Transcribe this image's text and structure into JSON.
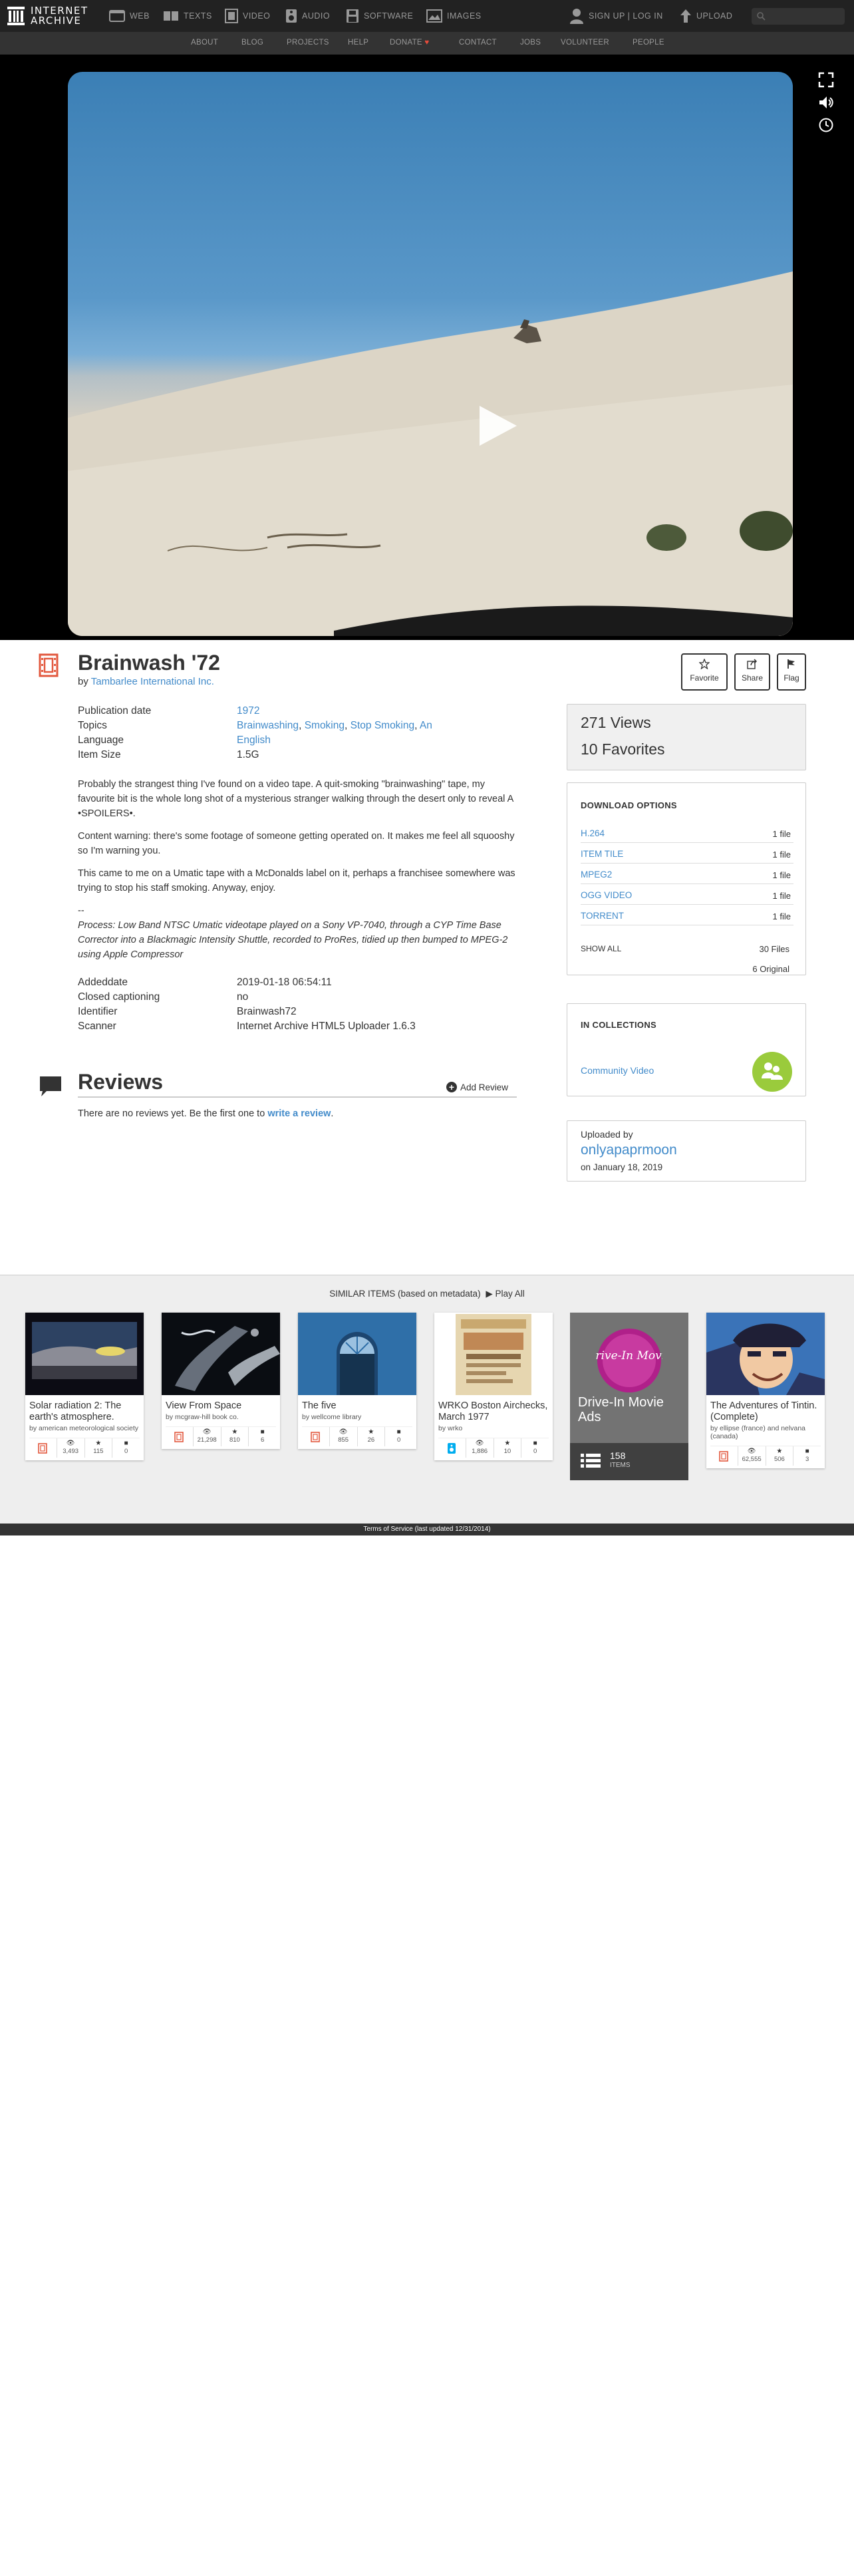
{
  "topnav": {
    "logo_line1": "INTERNET",
    "logo_line2": "ARCHIVE",
    "items": [
      {
        "label": "WEB",
        "icon": "web-icon"
      },
      {
        "label": "TEXTS",
        "icon": "book-icon"
      },
      {
        "label": "VIDEO",
        "icon": "film-icon"
      },
      {
        "label": "AUDIO",
        "icon": "speaker-icon"
      },
      {
        "label": "SOFTWARE",
        "icon": "floppy-icon"
      },
      {
        "label": "IMAGES",
        "icon": "image-icon"
      }
    ],
    "account": "SIGN UP | LOG IN",
    "upload": "UPLOAD"
  },
  "subnav": {
    "items": [
      "ABOUT",
      "BLOG",
      "PROJECTS",
      "HELP",
      "DONATE",
      "CONTACT",
      "JOBS",
      "VOLUNTEER",
      "PEOPLE"
    ],
    "donate_heart": "♥"
  },
  "item": {
    "title": "Brainwash '72",
    "by_prefix": "by",
    "creator": "Tambarlee International Inc.",
    "actions": {
      "favorite": "Favorite",
      "share": "Share",
      "flag": "Flag"
    }
  },
  "metadata": {
    "publication_date_label": "Publication date",
    "publication_date": "1972",
    "topics_label": "Topics",
    "topics": [
      "Brainwashing",
      "Smoking",
      "Stop Smoking",
      "An"
    ],
    "language_label": "Language",
    "language": "English",
    "item_size_label": "Item Size",
    "item_size": "1.5G",
    "addeddate_label": "Addeddate",
    "addeddate": "2019-01-18 06:54:11",
    "captioning_label": "Closed captioning",
    "captioning": "no",
    "identifier_label": "Identifier",
    "identifier": "Brainwash72",
    "scanner_label": "Scanner",
    "scanner": "Internet Archive HTML5 Uploader 1.6.3"
  },
  "description": {
    "p1": "Probably the strangest thing I've found on a video tape.  A quit-smoking \"brainwashing\" tape, my favourite bit is the whole long shot of a mysterious stranger walking through the desert only to reveal A •SPOILERS•.",
    "p2": "Content warning: there's some footage of someone getting operated on.  It makes me feel all squooshy so I'm warning you.",
    "p3": "This came to me on a Umatic tape with a McDonalds label on it, perhaps a franchisee somewhere was trying to stop his staff smoking. Anyway, enjoy.",
    "sep": "--",
    "p4": "Process: Low Band NTSC Umatic videotape played on a Sony VP-7040, through a CYP Time Base Corrector into a Blackmagic Intensity Shuttle, recorded to ProRes, tidied up then bumped to MPEG-2 using Apple Compressor"
  },
  "reviews": {
    "title": "Reviews",
    "add": "Add Review",
    "empty_prefix": "There are no reviews yet. Be the first one to",
    "empty_link": "write a review",
    "empty_suffix": "."
  },
  "stats": {
    "views": "271 Views",
    "favorites": "10 Favorites"
  },
  "downloads": {
    "title": "DOWNLOAD OPTIONS",
    "rows": [
      {
        "format": "H.264",
        "count": "1 file"
      },
      {
        "format": "ITEM TILE",
        "count": "1 file"
      },
      {
        "format": "MPEG2",
        "count": "1 file"
      },
      {
        "format": "OGG VIDEO",
        "count": "1 file"
      },
      {
        "format": "TORRENT",
        "count": "1 file"
      }
    ],
    "show_all": "SHOW ALL",
    "total": "30 Files",
    "original": "6 Original"
  },
  "collections": {
    "title": "IN COLLECTIONS",
    "items": [
      "Community Video"
    ]
  },
  "uploader": {
    "label": "Uploaded by",
    "name": "onlyapaprmoon",
    "date": "on January 18, 2019"
  },
  "similar": {
    "heading": "SIMILAR ITEMS (based on metadata)",
    "play_all": "Play All",
    "tiles": [
      {
        "title": "Solar radiation 2: The earth's atmosphere.",
        "by": "by american meteorological society",
        "views": "3,493",
        "favs": "115",
        "reviews": "0"
      },
      {
        "title": "View From Space",
        "by": "by mcgraw-hill book co.",
        "views": "21,298",
        "favs": "810",
        "reviews": "6"
      },
      {
        "title": "The five",
        "by": "by wellcome library",
        "views": "855",
        "favs": "26",
        "reviews": "0"
      },
      {
        "title": "WRKO Boston Airchecks, March 1977",
        "by": "by wrko",
        "views": "1,886",
        "favs": "10",
        "reviews": "0"
      },
      {
        "title": "Drive-In Movie Ads",
        "count": "158",
        "count_label": "ITEMS",
        "badge": "Drive-In Movie"
      },
      {
        "title": "The Adventures of Tintin. (Complete)",
        "by": "by ellipse (france) and nelvana (canada)",
        "views": "62,555",
        "favs": "506",
        "reviews": "3"
      }
    ]
  },
  "footer": "Terms of Service (last updated 12/31/2014)"
}
